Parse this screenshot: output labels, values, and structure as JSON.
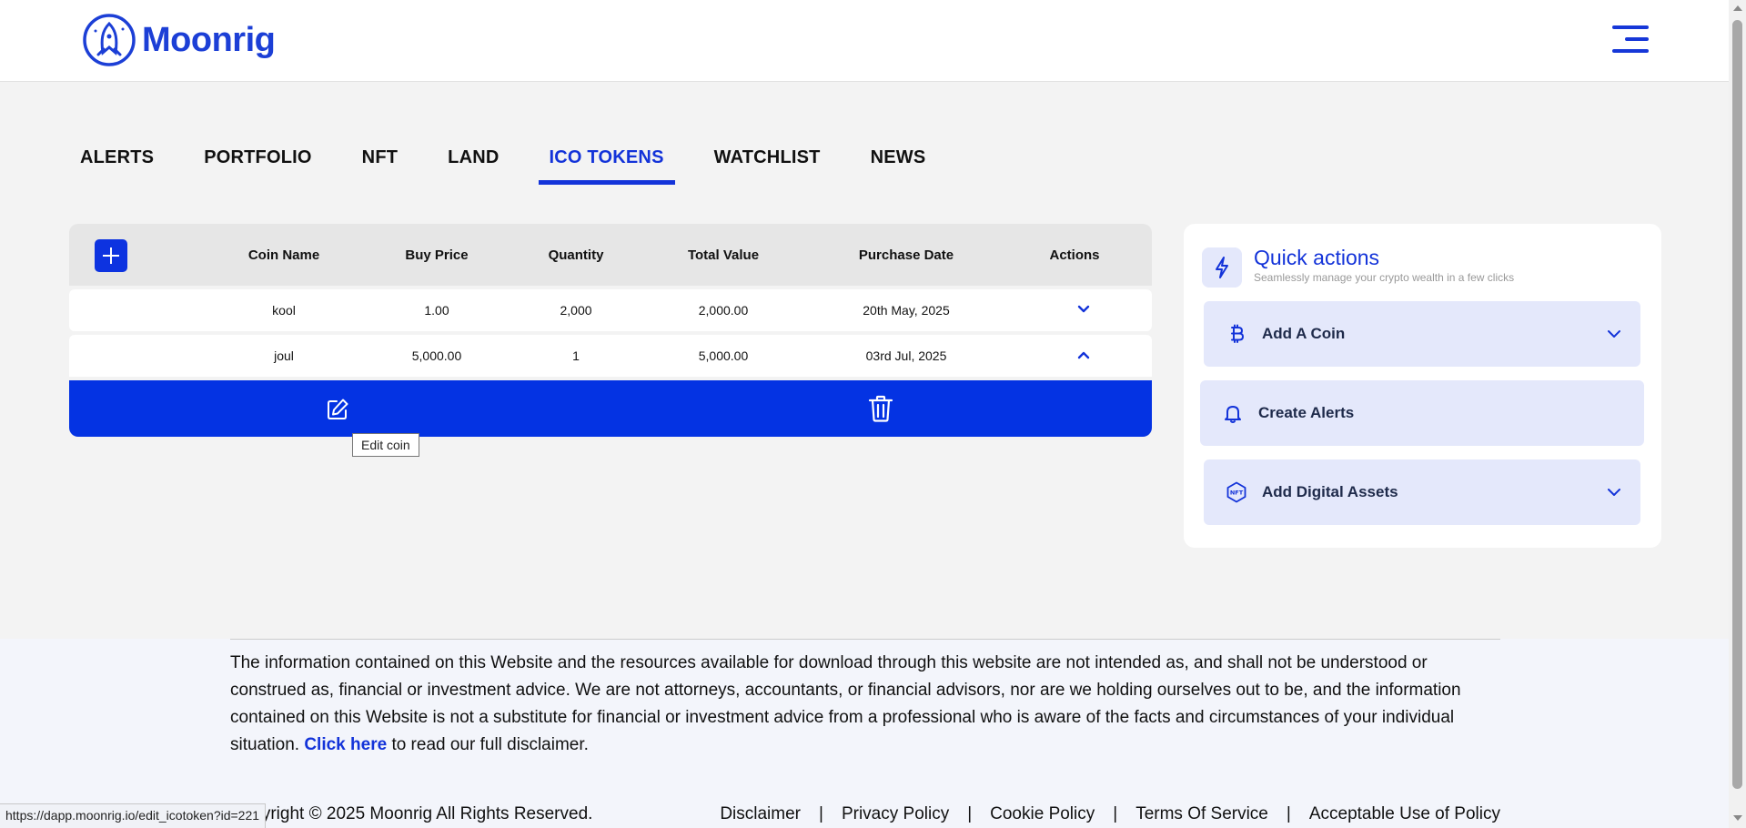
{
  "brand": {
    "name": "Moonrig"
  },
  "tabs": [
    {
      "label": "ALERTS",
      "active": false
    },
    {
      "label": "PORTFOLIO",
      "active": false
    },
    {
      "label": "NFT",
      "active": false
    },
    {
      "label": "LAND",
      "active": false
    },
    {
      "label": "ICO TOKENS",
      "active": true
    },
    {
      "label": "WATCHLIST",
      "active": false
    },
    {
      "label": "NEWS",
      "active": false
    }
  ],
  "table": {
    "columns": [
      "Coin Name",
      "Buy Price",
      "Quantity",
      "Total Value",
      "Purchase Date",
      "Actions"
    ],
    "rows": [
      {
        "coin": "kool",
        "buy_price": "1.00",
        "quantity": "2,000",
        "total": "2,000.00",
        "date": "20th May, 2025",
        "expanded": false
      },
      {
        "coin": "joul",
        "buy_price": "5,000.00",
        "quantity": "1",
        "total": "5,000.00",
        "date": "03rd Jul, 2025",
        "expanded": true
      }
    ],
    "tooltip": "Edit coin"
  },
  "quick_actions": {
    "title": "Quick actions",
    "subtitle": "Seamlessly manage your crypto wealth in a few clicks",
    "items": [
      {
        "label": "Add A Coin",
        "icon": "bitcoin-icon",
        "has_dropdown": true
      },
      {
        "label": "Create Alerts",
        "icon": "bell-icon",
        "has_dropdown": false
      },
      {
        "label": "Add Digital Assets",
        "icon": "nft-icon",
        "has_dropdown": true
      }
    ]
  },
  "footer": {
    "disclaimer_text": "The information contained on this Website and the resources available for download through this website are not intended as, and shall not be understood or construed as, financial or investment advice. We are not attorneys, accountants, or financial advisors, nor are we holding ourselves out to be, and the information contained on this Website is not a substitute for financial or investment advice from a professional who is aware of the facts and circumstances of your individual situation.",
    "click_here": "Click here",
    "disclaimer_suffix": "to read our full disclaimer.",
    "copyright": "Copyright © 2025 Moonrig All Rights Reserved.",
    "links": [
      "Disclaimer",
      "Privacy Policy",
      "Cookie Policy",
      "Terms Of Service",
      "Acceptable Use of Policy"
    ],
    "separator": "|"
  },
  "status_url": "https://dapp.moonrig.io/edit_icotoken?id=221",
  "colors": {
    "brand_blue": "#1333d9",
    "action_bar": "#0433e3",
    "quick_item_bg": "#e4e8fb"
  }
}
